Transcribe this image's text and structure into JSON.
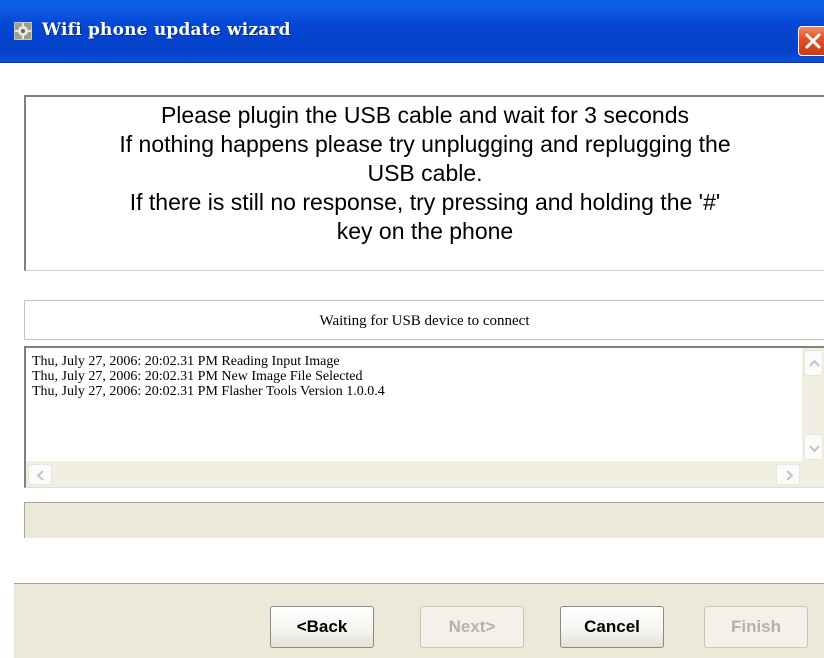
{
  "window": {
    "title": "Wifi phone update wizard",
    "app_icon": "gear-app-icon",
    "close_icon": "close-icon"
  },
  "message": {
    "lines": [
      "Please plugin the USB cable and wait for 3 seconds",
      "If nothing happens please try unplugging and replugging the",
      "USB cable.",
      "If there is still no response, try pressing and holding the '#'",
      "key on the phone"
    ]
  },
  "status": {
    "text": "Waiting for USB device to connect"
  },
  "log": {
    "entries": [
      "Thu, July 27, 2006:  20:02.31 PM  Reading Input Image",
      "Thu, July 27, 2006:  20:02.31 PM  New Image File Selected",
      "Thu, July 27, 2006:  20:02.31 PM  Flasher Tools Version 1.0.0.4"
    ]
  },
  "progress": {
    "value_percent": 0
  },
  "buttons": {
    "back": "<Back",
    "next": "Next>",
    "cancel": "Cancel",
    "finish": "Finish"
  },
  "colors": {
    "titlebar": "#0546d4",
    "close_button": "#e2532a",
    "dialog_face": "#ece9d8"
  }
}
